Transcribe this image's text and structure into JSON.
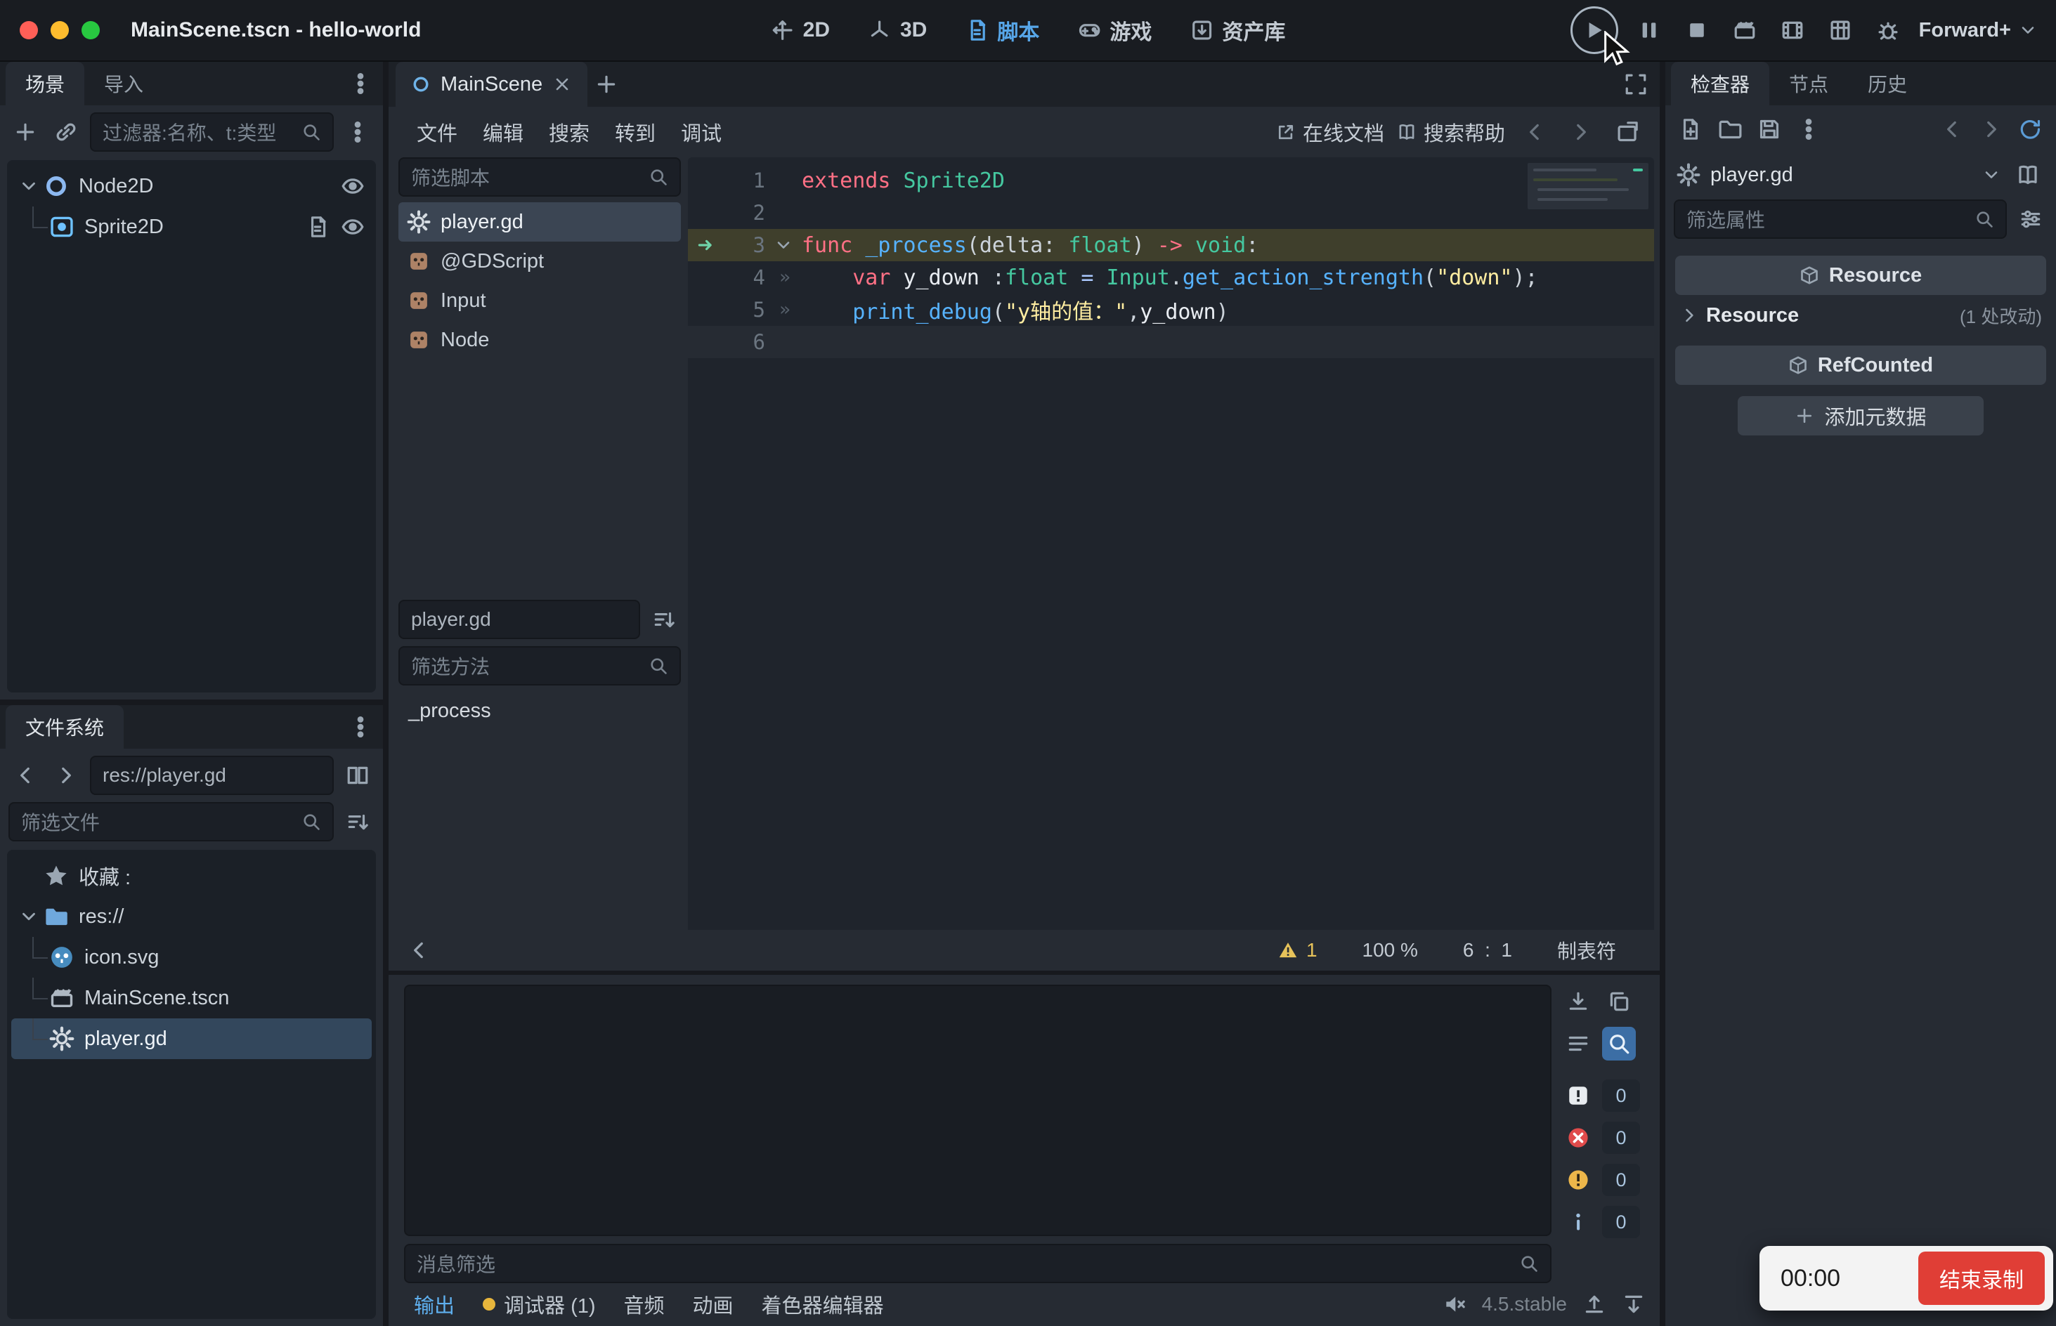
{
  "titlebar": {
    "title": "MainScene.tscn - hello-world",
    "workspaces": [
      {
        "id": "2d",
        "label": "2D",
        "active": false
      },
      {
        "id": "3d",
        "label": "3D",
        "active": false
      },
      {
        "id": "script",
        "label": "脚本",
        "active": true
      },
      {
        "id": "game",
        "label": "游戏",
        "active": false
      },
      {
        "id": "assetlib",
        "label": "资产库",
        "active": false
      }
    ],
    "renderer": "Forward+"
  },
  "scene_dock": {
    "tabs": [
      {
        "label": "场景",
        "active": true
      },
      {
        "label": "导入",
        "active": false
      }
    ],
    "filter_placeholder": "过滤器:名称、t:类型",
    "tree": [
      {
        "name": "Node2D",
        "depth": 0,
        "icon": "node2d",
        "expanded": true,
        "visible_toggle": true
      },
      {
        "name": "Sprite2D",
        "depth": 1,
        "icon": "sprite2d",
        "has_script": true,
        "visible_toggle": true
      }
    ]
  },
  "filesystem": {
    "tab": "文件系统",
    "path": "res://player.gd",
    "filter_placeholder": "筛选文件",
    "tree": [
      {
        "name": "收藏 :",
        "depth": 0,
        "icon": "star"
      },
      {
        "name": "res://",
        "depth": 0,
        "icon": "folder",
        "expanded": true
      },
      {
        "name": "icon.svg",
        "depth": 1,
        "icon": "godot"
      },
      {
        "name": "MainScene.tscn",
        "depth": 1,
        "icon": "clapper"
      },
      {
        "name": "player.gd",
        "depth": 1,
        "icon": "gear",
        "selected": true
      }
    ]
  },
  "scene_tabs": {
    "tab": "MainScene"
  },
  "script_editor": {
    "menus": [
      "文件",
      "编辑",
      "搜索",
      "转到",
      "调试"
    ],
    "online_docs": "在线文档",
    "search_help": "搜索帮助",
    "filter_scripts_placeholder": "筛选脚本",
    "scripts": [
      {
        "name": "player.gd",
        "icon": "gear",
        "selected": true
      },
      {
        "name": "@GDScript",
        "icon": "classdoc",
        "selected": false
      },
      {
        "name": "Input",
        "icon": "classdoc",
        "selected": false
      },
      {
        "name": "Node",
        "icon": "classdoc",
        "selected": false
      }
    ],
    "path_display": "player.gd",
    "filter_methods_placeholder": "筛选方法",
    "methods": [
      "_process"
    ],
    "status": {
      "warnings": "1",
      "zoom": "100 %",
      "line": "6",
      "sep": ":",
      "col": "1",
      "indent_type": "制表符"
    }
  },
  "code": {
    "lines": [
      {
        "num": "1",
        "tokens": [
          [
            "extends",
            "kw"
          ],
          [
            " ",
            "pl"
          ],
          [
            "Sprite2D",
            "ty"
          ]
        ]
      },
      {
        "num": "2",
        "tokens": []
      },
      {
        "num": "3",
        "exec": true,
        "fold": true,
        "tokens": [
          [
            "func",
            "kw"
          ],
          [
            " ",
            "pl"
          ],
          [
            "_process",
            "fn"
          ],
          [
            "(",
            "pl"
          ],
          [
            "delta",
            "pl"
          ],
          [
            ": ",
            "pl"
          ],
          [
            "float",
            "ty"
          ],
          [
            ")",
            "pl"
          ],
          [
            " ",
            "pl"
          ],
          [
            "->",
            "kw"
          ],
          [
            " ",
            "pl"
          ],
          [
            "void",
            "ty"
          ],
          [
            ":",
            "pl"
          ]
        ]
      },
      {
        "num": "4",
        "wrapmark": true,
        "tokens": [
          [
            "\t",
            "pl"
          ],
          [
            "var",
            "kw"
          ],
          [
            " ",
            "pl"
          ],
          [
            "y_down",
            "id"
          ],
          [
            " :",
            "pl"
          ],
          [
            "float",
            "ty"
          ],
          [
            " ",
            "pl"
          ],
          [
            "=",
            "op"
          ],
          [
            " ",
            "pl"
          ],
          [
            "Input",
            "ty"
          ],
          [
            ".",
            "pl"
          ],
          [
            "get_action_strength",
            "fn"
          ],
          [
            "(",
            "pl"
          ],
          [
            "\"down\"",
            "st"
          ],
          [
            ")",
            "pl"
          ],
          [
            ";",
            "pl"
          ]
        ]
      },
      {
        "num": "5",
        "wrapmark": true,
        "tokens": [
          [
            "\t",
            "pl"
          ],
          [
            "print_debug",
            "fn"
          ],
          [
            "(",
            "pl"
          ],
          [
            "\"y轴的值：\"",
            "st"
          ],
          [
            ",",
            "pl"
          ],
          [
            "y_down",
            "id"
          ],
          [
            ")",
            "pl"
          ]
        ]
      },
      {
        "num": "6",
        "current": true,
        "tokens": []
      }
    ]
  },
  "bottom_panel": {
    "message_filter_placeholder": "消息筛选",
    "badges": [
      {
        "kind": "alert",
        "count": "0"
      },
      {
        "kind": "error",
        "count": "0"
      },
      {
        "kind": "warning",
        "count": "0"
      },
      {
        "kind": "info",
        "count": "0"
      }
    ],
    "tabs": [
      {
        "label": "输出",
        "active": true,
        "dot": false
      },
      {
        "label": "调试器 (1)",
        "active": false,
        "dot": true
      },
      {
        "label": "音频",
        "active": false,
        "dot": false
      },
      {
        "label": "动画",
        "active": false,
        "dot": false
      },
      {
        "label": "着色器编辑器",
        "active": false,
        "dot": false
      }
    ],
    "version": "4.5.stable"
  },
  "inspector": {
    "tabs": [
      {
        "label": "检查器",
        "active": true
      },
      {
        "label": "节点",
        "active": false
      },
      {
        "label": "历史",
        "active": false
      }
    ],
    "object_name": "player.gd",
    "filter_placeholder": "筛选属性",
    "resource_header": "Resource",
    "resource_row": {
      "label": "Resource",
      "changes": "(1 处改动)"
    },
    "refcounted_header": "RefCounted",
    "add_metadata": "添加元数据"
  },
  "recorder": {
    "time": "00:00",
    "stop_label": "结束录制"
  }
}
